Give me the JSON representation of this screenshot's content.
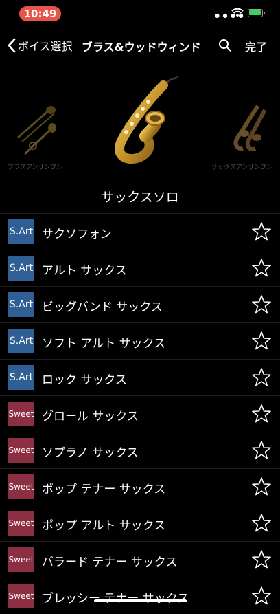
{
  "status_bar": {
    "time": "10:49"
  },
  "nav": {
    "back_label": "ボイス選択",
    "title": "ブラス&ウッドウィンド",
    "done_label": "完了"
  },
  "carousel": {
    "left_label": "ブラスアンサンブル",
    "right_label": "サックスアンサンブル"
  },
  "category_title": "サックスソロ",
  "voices": [
    {
      "badge": "S.Art",
      "type": "sart",
      "name": "サクソフォン"
    },
    {
      "badge": "S.Art",
      "type": "sart",
      "name": "アルト サックス"
    },
    {
      "badge": "S.Art",
      "type": "sart",
      "name": "ビッグバンド サックス"
    },
    {
      "badge": "S.Art",
      "type": "sart",
      "name": "ソフト アルト サックス"
    },
    {
      "badge": "S.Art",
      "type": "sart",
      "name": "ロック サックス"
    },
    {
      "badge": "Sweet",
      "type": "sweet",
      "name": "グロール サックス"
    },
    {
      "badge": "Sweet",
      "type": "sweet",
      "name": "ソプラノ サックス"
    },
    {
      "badge": "Sweet",
      "type": "sweet",
      "name": "ポップ テナー サックス"
    },
    {
      "badge": "Sweet",
      "type": "sweet",
      "name": "ポップ アルト サックス"
    },
    {
      "badge": "Sweet",
      "type": "sweet",
      "name": "バラード テナー サックス"
    },
    {
      "badge": "Sweet",
      "type": "sweet",
      "name": "ブレッシー テナー サックス"
    }
  ]
}
